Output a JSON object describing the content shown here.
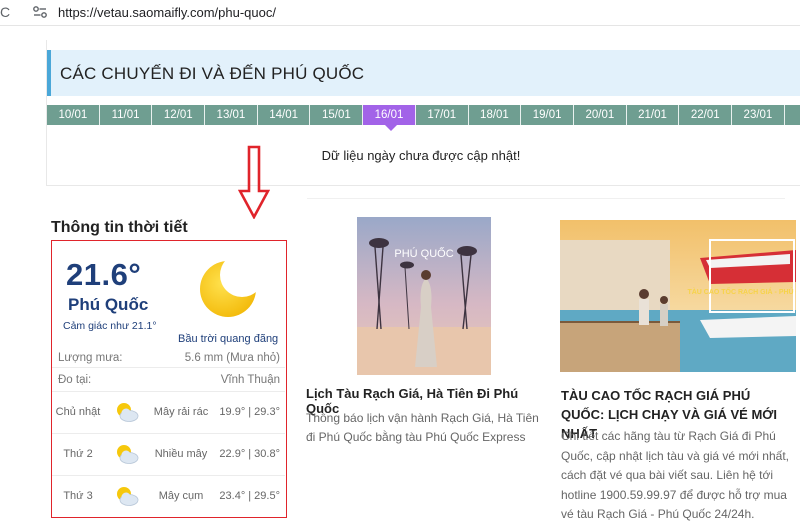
{
  "browser": {
    "url": "https://vetau.saomaifly.com/phu-quoc/"
  },
  "trips": {
    "title": "CÁC CHUYẾN ĐI VÀ ĐẾN PHÚ QUỐC",
    "dates": [
      "10/01",
      "11/01",
      "12/01",
      "13/01",
      "14/01",
      "15/01",
      "16/01",
      "17/01",
      "18/01",
      "19/01",
      "20/01",
      "21/01",
      "22/01",
      "23/01"
    ],
    "active_date": "16/01",
    "empty_message": "Dữ liệu ngày chưa được cập nhật!"
  },
  "weather": {
    "title": "Thông tin thời tiết",
    "temperature": "21.6°",
    "city": "Phú Quốc",
    "feels_like": "Cảm giác như 21.1°",
    "condition": "Bầu trời quang đãng",
    "rain_label": "Lượng mưa:",
    "rain_value": "5.6 mm (Mưa nhỏ)",
    "location_label": "Đo tại:",
    "location_value": "Vĩnh Thuận",
    "forecast": [
      {
        "day": "Chủ nhật",
        "desc": "Mây rải rác",
        "temp": "19.9° | 29.3°"
      },
      {
        "day": "Thứ 2",
        "desc": "Nhiều mây",
        "temp": "22.9° | 30.8°"
      },
      {
        "day": "Thứ 3",
        "desc": "Mây cụm",
        "temp": "23.4° | 29.5°"
      }
    ],
    "icons": {
      "current": "crescent-moon-icon",
      "forecast": "sun-behind-cloud-icon"
    },
    "colors": {
      "accent": "#1f3f7a",
      "moon": "#f6c80c",
      "border": "#e0242b"
    }
  },
  "articles": [
    {
      "image_text": "PHÚ QUỐC",
      "title": "Lịch Tàu Rạch Giá, Hà Tiên Đi Phú Quốc",
      "desc": "Thông báo lịch vận hành Rạch Giá, Hà Tiên đi Phú Quốc bằng tàu Phú Quốc Express"
    },
    {
      "image_text": "TÀU CAO TỐC RẠCH GIÁ - PHÚ QUỐC",
      "title": "TÀU CAO TỐC RẠCH GIÁ PHÚ QUỐC: LỊCH CHẠY VÀ GIÁ VÉ MỚI NHẤT",
      "desc": "Chi tiết các hãng tàu từ Rạch Giá đi Phú Quốc, cập nhật lịch tàu và giá vé mới nhất, cách đặt vé qua bài viết sau. Liên hệ tới hotline 1900.59.99.97 để được hỗ trợ mua vé tàu Rạch Giá - Phú Quốc 24/24h."
    }
  ]
}
